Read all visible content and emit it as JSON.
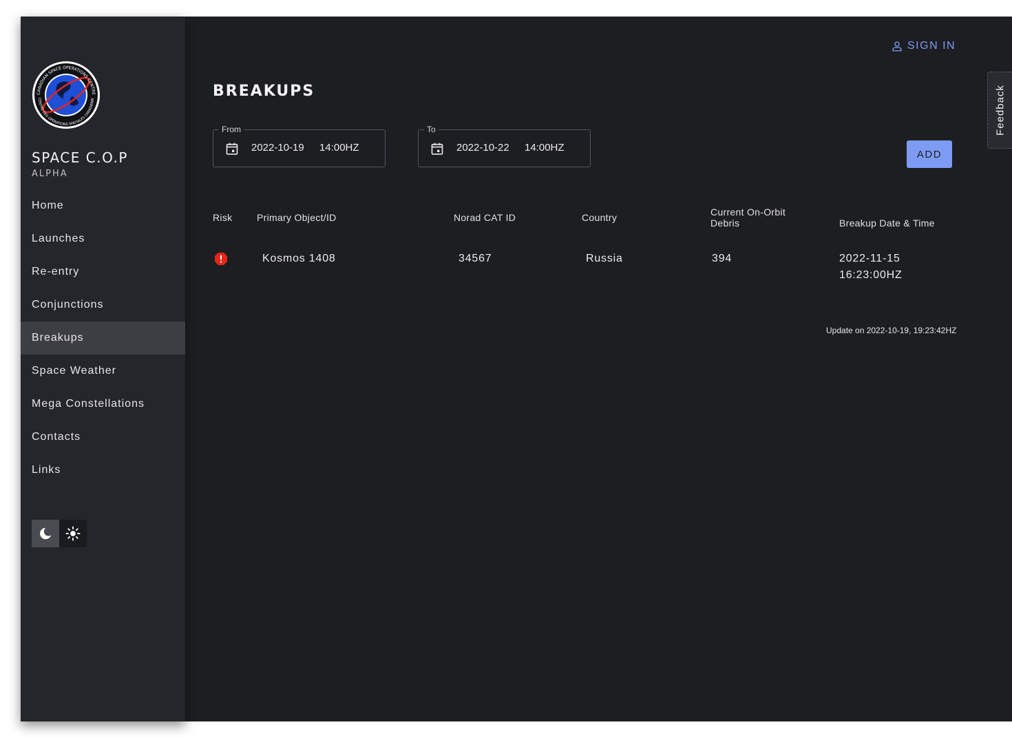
{
  "brand": {
    "title": "SPACE C.O.P",
    "subtitle": "ALPHA",
    "logo_ring_text_top": "CANADIAN SPACE OPERATIONS CENTRE",
    "logo_ring_text_bottom": "CENTRE DES OPÉRATIONS SPATIALES CANADIENNES"
  },
  "nav": {
    "items": [
      {
        "label": "Home"
      },
      {
        "label": "Launches"
      },
      {
        "label": "Re-entry"
      },
      {
        "label": "Conjunctions"
      },
      {
        "label": "Breakups",
        "active": true
      },
      {
        "label": "Space Weather"
      },
      {
        "label": "Mega Constellations"
      },
      {
        "label": "Contacts"
      },
      {
        "label": "Links"
      }
    ]
  },
  "theme": {
    "selected": "dark",
    "options": [
      "moon-icon",
      "sun-icon"
    ]
  },
  "header": {
    "signin_label": "SIGN IN"
  },
  "page": {
    "title": "BREAKUPS"
  },
  "filters": {
    "from": {
      "legend": "From",
      "date": "2022-10-19",
      "time": "14:00HZ"
    },
    "to": {
      "legend": "To",
      "date": "2022-10-22",
      "time": "14:00HZ"
    }
  },
  "actions": {
    "add_label": "ADD"
  },
  "feedback": {
    "label": "Feedback"
  },
  "table": {
    "headers": {
      "risk": "Risk",
      "primary": "Primary Object/ID",
      "norad": "Norad CAT ID",
      "country": "Country",
      "debris": "Current On-Orbit Debris",
      "datetime": "Breakup Date & Time"
    },
    "rows": [
      {
        "risk": "alert-icon",
        "primary": "Kosmos 1408",
        "norad": "34567",
        "country": "Russia",
        "debris": "394",
        "date": "2022-11-15",
        "time": "16:23:00HZ"
      }
    ]
  },
  "update_note": "Update on 2022-10-19, 19:23:42HZ",
  "colors": {
    "background": "#1d1e22",
    "sidebar": "#25262b",
    "accent": "#7e9bf4",
    "risk_red": "#e3261c",
    "active_nav": "#3d3e43"
  }
}
